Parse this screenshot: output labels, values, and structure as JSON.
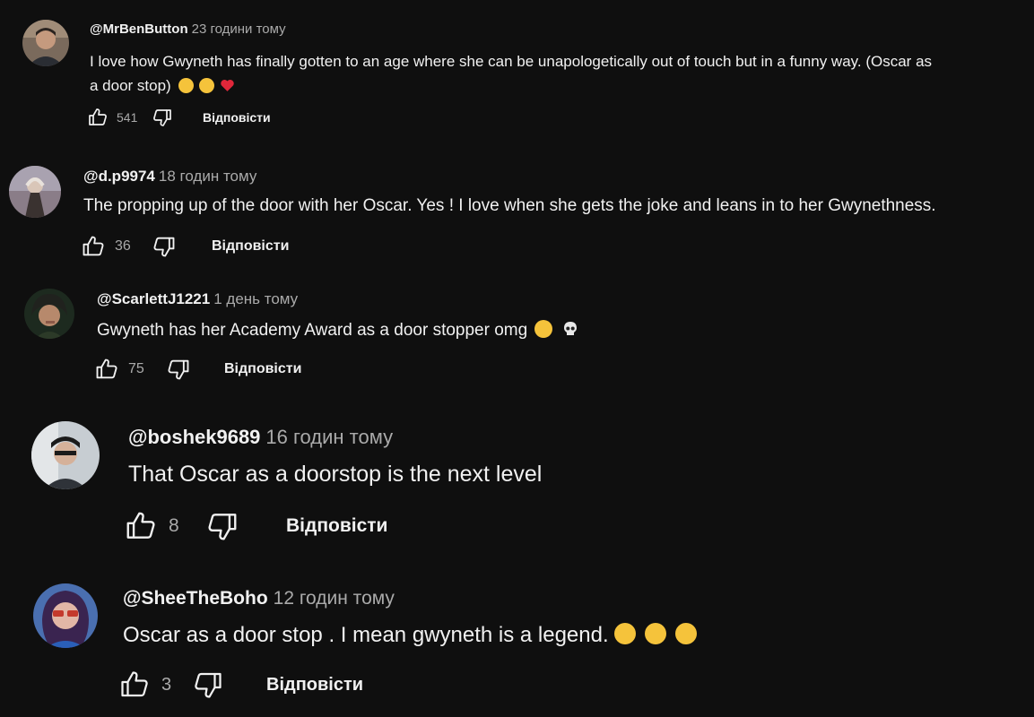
{
  "comments": [
    {
      "handle": "@MrBenButton",
      "time": "23 години тому",
      "text_line1": "I love how Gwyneth has finally gotten to an age where she can be unapologetically out of touch but in a funny way. (Oscar as",
      "text_line2": "a door stop)",
      "emojis": [
        "grinning-sweat-emoji",
        "grinning-sweat-emoji",
        "red-heart-emoji"
      ],
      "likes": "541",
      "reply_label": "Відповісти"
    },
    {
      "handle": "@d.p9974",
      "time": "18 годин тому",
      "text": "The propping up of the door with her Oscar. Yes ! I love when she gets the joke and leans in to her Gwynethness.",
      "likes": "36",
      "reply_label": "Відповісти"
    },
    {
      "handle": "@ScarlettJ1221",
      "time": "1 день тому",
      "text": "Gwyneth has her Academy Award as a door stopper omg",
      "emojis": [
        "rolling-laughing-emoji",
        "skull-emoji"
      ],
      "likes": "75",
      "reply_label": "Відповісти"
    },
    {
      "handle": "@boshek9689",
      "time": "16 годин тому",
      "text": "That Oscar as a doorstop is the next level",
      "likes": "8",
      "reply_label": "Відповісти"
    },
    {
      "handle": "@SheeTheBoho",
      "time": "12 годин тому",
      "text": "Oscar as a door stop . I mean gwyneth is a legend.",
      "emojis": [
        "rolling-laughing-emoji",
        "rolling-laughing-emoji",
        "rolling-laughing-emoji"
      ],
      "likes": "3",
      "reply_label": "Відповісти"
    }
  ],
  "icons": {
    "like": "thumbs-up-icon",
    "dislike": "thumbs-down-icon"
  },
  "colors": {
    "background": "#0f0f0f",
    "primary_text": "#f1f1f1",
    "secondary_text": "#aaaaaa"
  }
}
